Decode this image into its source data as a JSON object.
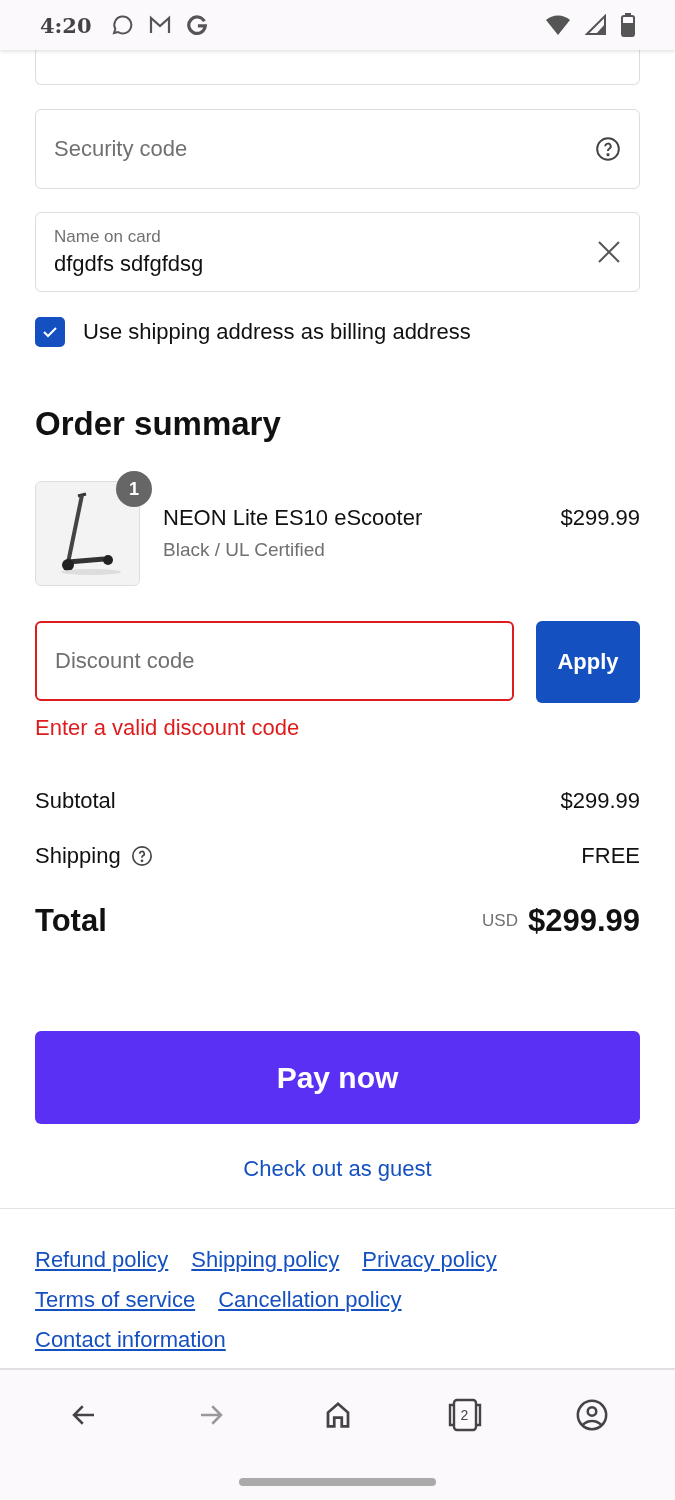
{
  "status_bar": {
    "time": "4:20"
  },
  "payment": {
    "security_code": {
      "placeholder": "Security code"
    },
    "name_on_card": {
      "label": "Name on card",
      "value": "dfgdfs sdfgfdsg"
    },
    "billing_same": {
      "label": "Use shipping address as billing address",
      "checked": true
    }
  },
  "order_summary": {
    "title": "Order summary",
    "items": [
      {
        "quantity": "1",
        "name": "NEON Lite ES10 eScooter",
        "variant": "Black / UL Certified",
        "price": "$299.99"
      }
    ],
    "discount": {
      "placeholder": "Discount code",
      "invalid": true,
      "error": "Enter a valid discount code",
      "button": "Apply"
    },
    "lines": [
      {
        "label": "Subtotal",
        "value": "$299.99",
        "help": false
      },
      {
        "label": "Shipping",
        "value": "FREE",
        "help": true
      }
    ],
    "total": {
      "label": "Total",
      "currency": "USD",
      "value": "$299.99"
    }
  },
  "pay_button": "Pay now",
  "guest_link": "Check out as guest",
  "footer_links": [
    [
      "Refund policy",
      "Shipping policy",
      "Privacy policy"
    ],
    [
      "Terms of service",
      "Cancellation policy"
    ],
    [
      "Contact information"
    ]
  ],
  "browser_nav": {
    "back_enabled": true,
    "forward_enabled": false,
    "tab_count": "2"
  }
}
